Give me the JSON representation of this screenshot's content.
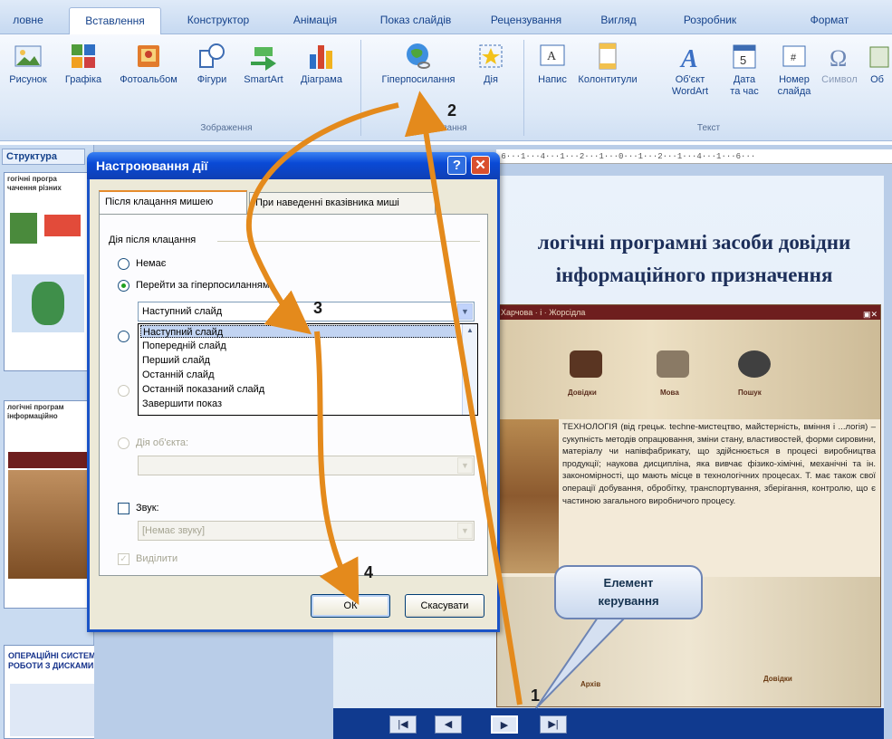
{
  "ribbon": {
    "tabs": [
      "ловне",
      "Вставлення",
      "Конструктор",
      "Анімація",
      "Показ слайдів",
      "Рецензування",
      "Вигляд",
      "Розробник",
      "Формат"
    ],
    "buttons": {
      "picture": "Рисунок",
      "graphics": "Графіка",
      "photo_album": "Фотоальбом",
      "shapes": "Фігури",
      "smartart": "SmartArt",
      "chart": "Діаграма",
      "hyperlink": "Гіперпосилання",
      "action": "Дія",
      "text_box": "Напис",
      "header_footer": "Колонтитули",
      "wordart_1": "Об'єкт",
      "wordart_2": "WordArt",
      "date_time_1": "Дата",
      "date_time_2": "та час",
      "slide_number_1": "Номер",
      "slide_number_2": "слайда",
      "symbol": "Символ",
      "object": "Об"
    },
    "groups": {
      "images": "Зображення",
      "links": "Посилання",
      "text": "Текст"
    }
  },
  "left_pane": {
    "tab_label": "Структура",
    "thumb1_title": "гогічні програ чачення різних",
    "thumb2_title": "логічні програм інформаційно",
    "thumb3_title": "ОПЕРАЦІЙНІ СИСТЕМИ ОВЕЙ РОБОТИ З ДИСКАМИ"
  },
  "ruler_text": "·6···1···4···1···2···1···0···1···2···1···4···1···6···",
  "slide": {
    "title": "логічні програмні засоби довідни інформаційного призначення",
    "inner_bar": "Харчова · і · Жорсідла",
    "nav_labels": [
      "Довідки",
      "Мова",
      "Пошук"
    ],
    "body_text": "ТЕХНОЛОГІЯ (від грецьк. techne-мистецтво, майстерність, вміння і ...логія) – сукупність методів опрацювання, зміни стану, властивостей, форми сировини, матеріалу чи напівфабрикату, що здійснюється в процесі виробництва продукції; наукова дисципліна, яка вивчає фізико-хімічні, механічні та ін. закономірності, що мають місце в технологічних процесах. Т. має також свої операції добування, обробітку, транспортування, зберігання, контролю, що є частиною загального виробничого процесу.",
    "bottom_labels": [
      "Архів",
      "Довідки"
    ],
    "nav_buttons": [
      "|◀",
      "◀",
      "▶",
      "▶|"
    ]
  },
  "callout_text": "Елемент керування",
  "steps": [
    "1",
    "2",
    "3",
    "4"
  ],
  "dialog": {
    "title": "Настроювання дії",
    "help_btn": "?",
    "close_btn": "✕",
    "tabs": [
      "Після клацання мишею",
      "При наведенні вказівника миші"
    ],
    "section_label": "Дія після клацання",
    "radio_none": "Немає",
    "radio_hyperlink": "Перейти за гіперпосиланням:",
    "combo_value": "Наступний слайд",
    "dropdown_items": [
      "Наступний слайд",
      "Попередній слайд",
      "Перший слайд",
      "Останній слайд",
      "Останній показаний слайд",
      "Завершити показ"
    ],
    "radio_object": "Дія об'єкта:",
    "sound_label": "Звук:",
    "sound_value": "[Немає звуку]",
    "highlight_label": "Виділити",
    "ok_button": "ОК",
    "cancel_button": "Скасувати"
  },
  "colors": {
    "arrow": "#e48a1c",
    "dialog_title": "#0a4ad6"
  }
}
